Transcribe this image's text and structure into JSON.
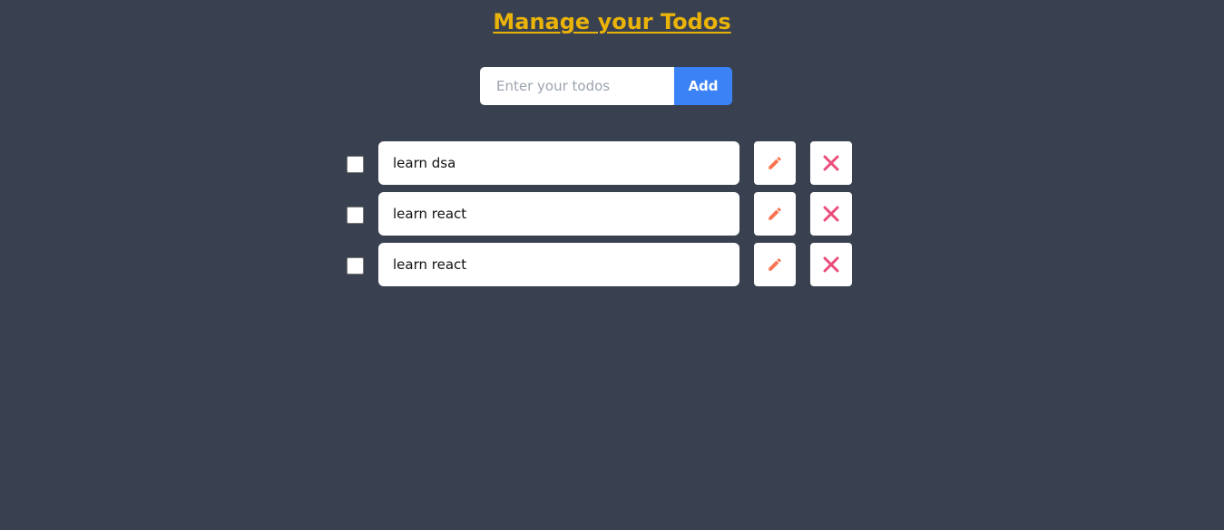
{
  "header": {
    "title": "Manage your Todos"
  },
  "add_form": {
    "placeholder": "Enter your todos",
    "value": "",
    "button_label": "Add"
  },
  "todos": [
    {
      "text": "learn dsa",
      "completed": false
    },
    {
      "text": "learn react",
      "completed": false
    },
    {
      "text": "learn react",
      "completed": false
    }
  ],
  "icons": {
    "edit": "pencil-icon",
    "delete": "close-icon"
  },
  "colors": {
    "background": "#394150",
    "title": "#eab308",
    "add_button": "#3b82f6",
    "edit_icon": "#f97350",
    "delete_icon": "#ec4c7a"
  }
}
